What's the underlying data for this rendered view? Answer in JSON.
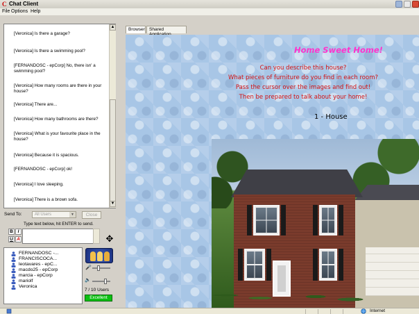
{
  "window": {
    "title": "Chat Client",
    "app_icon": "C"
  },
  "menu": [
    "File",
    "Options",
    "Help"
  ],
  "chat": {
    "messages": [
      "[Veronica] Is there a garage?",
      "[Veronica] Is there a swimming pool?",
      "[FERNANDOSC - epCorp] No, there isn' a swimming pool?",
      "[Veronica] How many rooms are there in your house?",
      "[Veronica] There are...",
      "[Veronica] How many bathrooms are there?",
      "[Veronica] What is your favourite place in the house?",
      "[Veronica] Because it is spacious.",
      "[FERNANDOSC - epCorp] ok!",
      "[Veronica] I love sleeping.",
      "[Veronica] There is a brown sofa."
    ]
  },
  "compose": {
    "send_to_label": "Send To:",
    "send_to_value": "All Users",
    "close_label": "Close",
    "hint": "Type text below, hit ENTER to send.",
    "bold_label": "B",
    "italic_label": "I",
    "underline_label": "U",
    "color_label": "A"
  },
  "users": [
    "FERNANDOSC -...",
    "FRANCISCOCA...",
    "leotavares - epC...",
    "macdo25 - epCorp",
    "marcia - epCorp",
    "mariolf",
    "Veronica"
  ],
  "voice": {
    "user_count": "7 / 10 Users",
    "status": "Excellent",
    "status_color": "#0cbf12"
  },
  "tabs": [
    "Browser",
    "Shared Application"
  ],
  "browser": {
    "heading": "Home Sweet Home!",
    "prompt_lines": [
      "Can you describe this house?",
      "What pieces of furniture do you find in each room?",
      "Pass the cursor over the images and find out!",
      "Then be prepared to talk about your home!"
    ],
    "section_title": "1 - House",
    "heading_color": "#ff33cc",
    "prompt_color": "#d41010"
  },
  "statusbar": {
    "zone": "Internet"
  }
}
